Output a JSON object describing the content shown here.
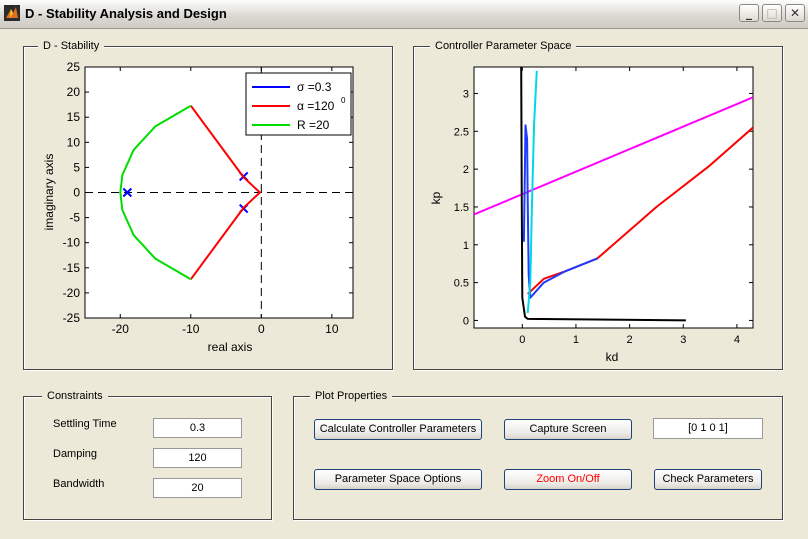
{
  "window": {
    "title": "D - Stability Analysis and Design",
    "controls": {
      "minimize": "_",
      "maximize": "□",
      "close": "✕"
    }
  },
  "d_stability": {
    "title": "D - Stability",
    "xlabel": "real axis",
    "ylabel": "imaginary axis",
    "xticks": [
      "-20",
      "-10",
      "0",
      "10"
    ],
    "yticks": [
      "25",
      "20",
      "15",
      "10",
      "5",
      "0",
      "-5",
      "-10",
      "-15",
      "-20",
      "-25"
    ],
    "legend": {
      "sigma": "σ =0.3",
      "alpha": "α =120",
      "alpha_sup": "0",
      "radius": "R =20"
    }
  },
  "controller_space": {
    "title": "Controller Parameter Space",
    "xlabel": "kd",
    "ylabel": "kp",
    "xticks": [
      "0",
      "1",
      "2",
      "3",
      "4"
    ],
    "yticks": [
      "3",
      "2.5",
      "2",
      "1.5",
      "1",
      "0.5",
      "0"
    ]
  },
  "chart_data": [
    {
      "type": "line",
      "title": "D - Stability",
      "xlabel": "real axis",
      "ylabel": "imaginary axis",
      "xlim": [
        -25,
        13
      ],
      "ylim": [
        -25,
        25
      ],
      "legend_position": "top-right",
      "grid": false,
      "series": [
        {
          "name": "σ =0.3",
          "color": "#0000ff",
          "kind": "markers-x",
          "points": [
            [
              -19,
              0
            ],
            [
              -2.5,
              3.2
            ],
            [
              -2.5,
              -3.2
            ]
          ]
        },
        {
          "name": "α =120°",
          "color": "#ff0000",
          "points": [
            [
              -10,
              17.3
            ],
            [
              -2.5,
              3
            ],
            [
              -0.2,
              0
            ],
            [
              -2.5,
              -3
            ],
            [
              -10,
              -17.3
            ]
          ]
        },
        {
          "name": "R =20",
          "color": "#00dd00",
          "points": [
            [
              -10,
              17.3
            ],
            [
              -15,
              13.2
            ],
            [
              -18.1,
              8.5
            ],
            [
              -19.7,
              3.5
            ],
            [
              -20,
              0
            ],
            [
              -19.7,
              -3.5
            ],
            [
              -18.1,
              -8.5
            ],
            [
              -15,
              -13.2
            ],
            [
              -10,
              -17.3
            ]
          ]
        }
      ],
      "reference_lines": [
        {
          "axis": "x",
          "value": 0,
          "style": "dashed"
        },
        {
          "axis": "y",
          "value": 0,
          "style": "dashed"
        }
      ]
    },
    {
      "type": "line",
      "title": "Controller Parameter Space",
      "xlabel": "kd",
      "ylabel": "kp",
      "xlim": [
        -0.9,
        4.3
      ],
      "ylim": [
        -0.1,
        3.35
      ],
      "grid": false,
      "series": [
        {
          "color": "#ff00ff",
          "points": [
            [
              -0.9,
              1.4
            ],
            [
              4.3,
              2.95
            ]
          ]
        },
        {
          "color": "#ff0000",
          "points": [
            [
              0.1,
              0.35
            ],
            [
              0.4,
              0.55
            ],
            [
              0.8,
              0.65
            ],
            [
              1.4,
              0.82
            ],
            [
              2.5,
              1.5
            ],
            [
              3.5,
              2.05
            ],
            [
              4.3,
              2.55
            ]
          ]
        },
        {
          "color": "#1e3cff",
          "points": [
            [
              0.0,
              1.1
            ],
            [
              0.03,
              1.05
            ],
            [
              0.06,
              2.58
            ],
            [
              0.09,
              2.4
            ],
            [
              0.1,
              1.6
            ],
            [
              0.12,
              0.6
            ],
            [
              0.15,
              0.3
            ],
            [
              0.4,
              0.5
            ],
            [
              0.8,
              0.65
            ],
            [
              1.4,
              0.82
            ]
          ]
        },
        {
          "color": "#00d8e8",
          "points": [
            [
              0.1,
              0.1
            ],
            [
              0.15,
              0.5
            ],
            [
              0.18,
              1.5
            ],
            [
              0.22,
              2.6
            ],
            [
              0.27,
              3.3
            ]
          ]
        },
        {
          "color": "#000000",
          "points": [
            [
              -0.02,
              3.35
            ],
            [
              -0.01,
              1.5
            ],
            [
              0.0,
              0.3
            ],
            [
              0.05,
              0.05
            ],
            [
              0.1,
              0.02
            ],
            [
              3.05,
              0.0
            ]
          ]
        }
      ]
    }
  ],
  "constraints": {
    "title": "Constraints",
    "settling_time": {
      "label": "Settling Time",
      "value": "0.3"
    },
    "damping": {
      "label": "Damping",
      "value": "120"
    },
    "bandwidth": {
      "label": "Bandwidth",
      "value": "20"
    }
  },
  "plot_properties": {
    "title": "Plot Properties",
    "calc_button": "Calculate Controller Parameters",
    "capture_button": "Capture Screen",
    "vector_value": "[0 1 0 1]",
    "options_button": "Parameter Space Options",
    "zoom_button": "Zoom On/Off",
    "zoom_color": "#ff0000",
    "check_button": "Check Parameters"
  }
}
